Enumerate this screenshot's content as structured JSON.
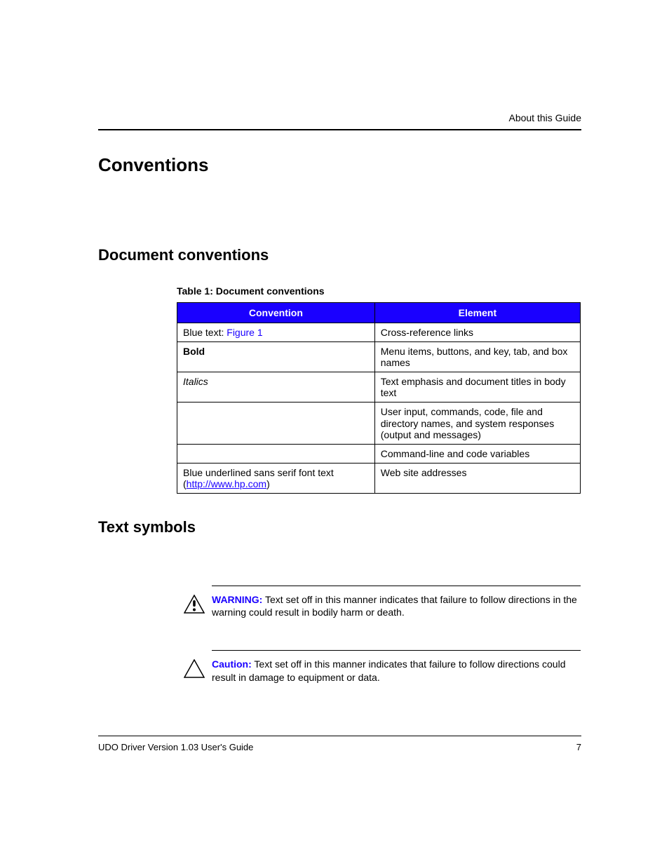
{
  "header": {
    "section": "About this Guide"
  },
  "titles": {
    "main": "Conventions",
    "sub_doc": "Document conventions",
    "sub_text": "Text symbols"
  },
  "table": {
    "caption": "Table 1:  Document conventions",
    "col1": "Convention",
    "col2": "Element",
    "r1c1_pre": "Blue text: ",
    "r1c1_link": "Figure 1",
    "r1c2": "Cross-reference links",
    "r2c1": "Bold",
    "r2c2": "Menu items, buttons, and key, tab, and box names",
    "r3c1": "Italics",
    "r3c2": "Text emphasis and document titles in body text",
    "r4c1": "",
    "r4c2": "User input, commands, code, file and directory names, and system responses (output and messages)",
    "r5c1": "",
    "r5c2": "Command-line and code variables",
    "r6c1_pre": "Blue underlined sans serif font text (",
    "r6c1_link": "http://www.hp.com",
    "r6c1_post": ")",
    "r6c2": "Web site addresses"
  },
  "warning": {
    "label": "WARNING:",
    "text": "  Text set off in this manner indicates that failure to follow directions in the warning could result in bodily harm or death."
  },
  "caution": {
    "label": "Caution:",
    "text": "  Text set off in this manner indicates that failure to follow directions could result in damage to equipment or data."
  },
  "footer": {
    "left": "UDO Driver Version 1.03 User's Guide",
    "right": "7"
  }
}
